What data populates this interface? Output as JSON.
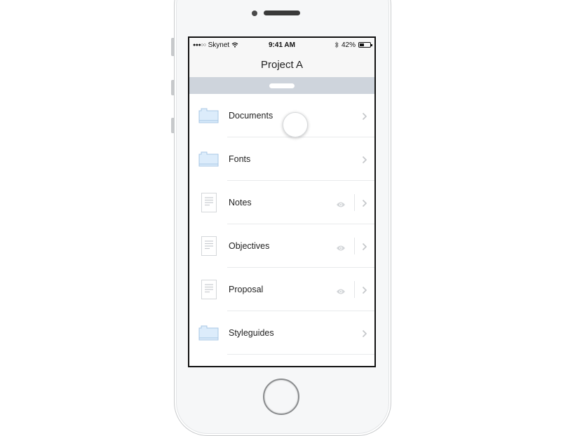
{
  "status_bar": {
    "signal": "●●●○○",
    "carrier": "Skynet",
    "wifi_icon": "wifi-icon",
    "time": "9:41 AM",
    "bluetooth_icon": "bluetooth-icon",
    "battery": "42%",
    "battery_level": 0.42
  },
  "nav": {
    "title": "Project A"
  },
  "pull_handle": "pull-handle",
  "list": {
    "items": [
      {
        "label": "Documents",
        "type": "folder",
        "preview": false
      },
      {
        "label": "Fonts",
        "type": "folder",
        "preview": false
      },
      {
        "label": "Notes",
        "type": "document",
        "preview": true
      },
      {
        "label": "Objectives",
        "type": "document",
        "preview": true
      },
      {
        "label": "Proposal",
        "type": "document",
        "preview": true
      },
      {
        "label": "Styleguides",
        "type": "folder",
        "preview": false
      }
    ]
  },
  "colors": {
    "folder_fill": "#dcecfb",
    "folder_stroke": "#a9c7e4",
    "pull_bar": "#ced4dc",
    "icon_gray": "#c8ccd0"
  }
}
